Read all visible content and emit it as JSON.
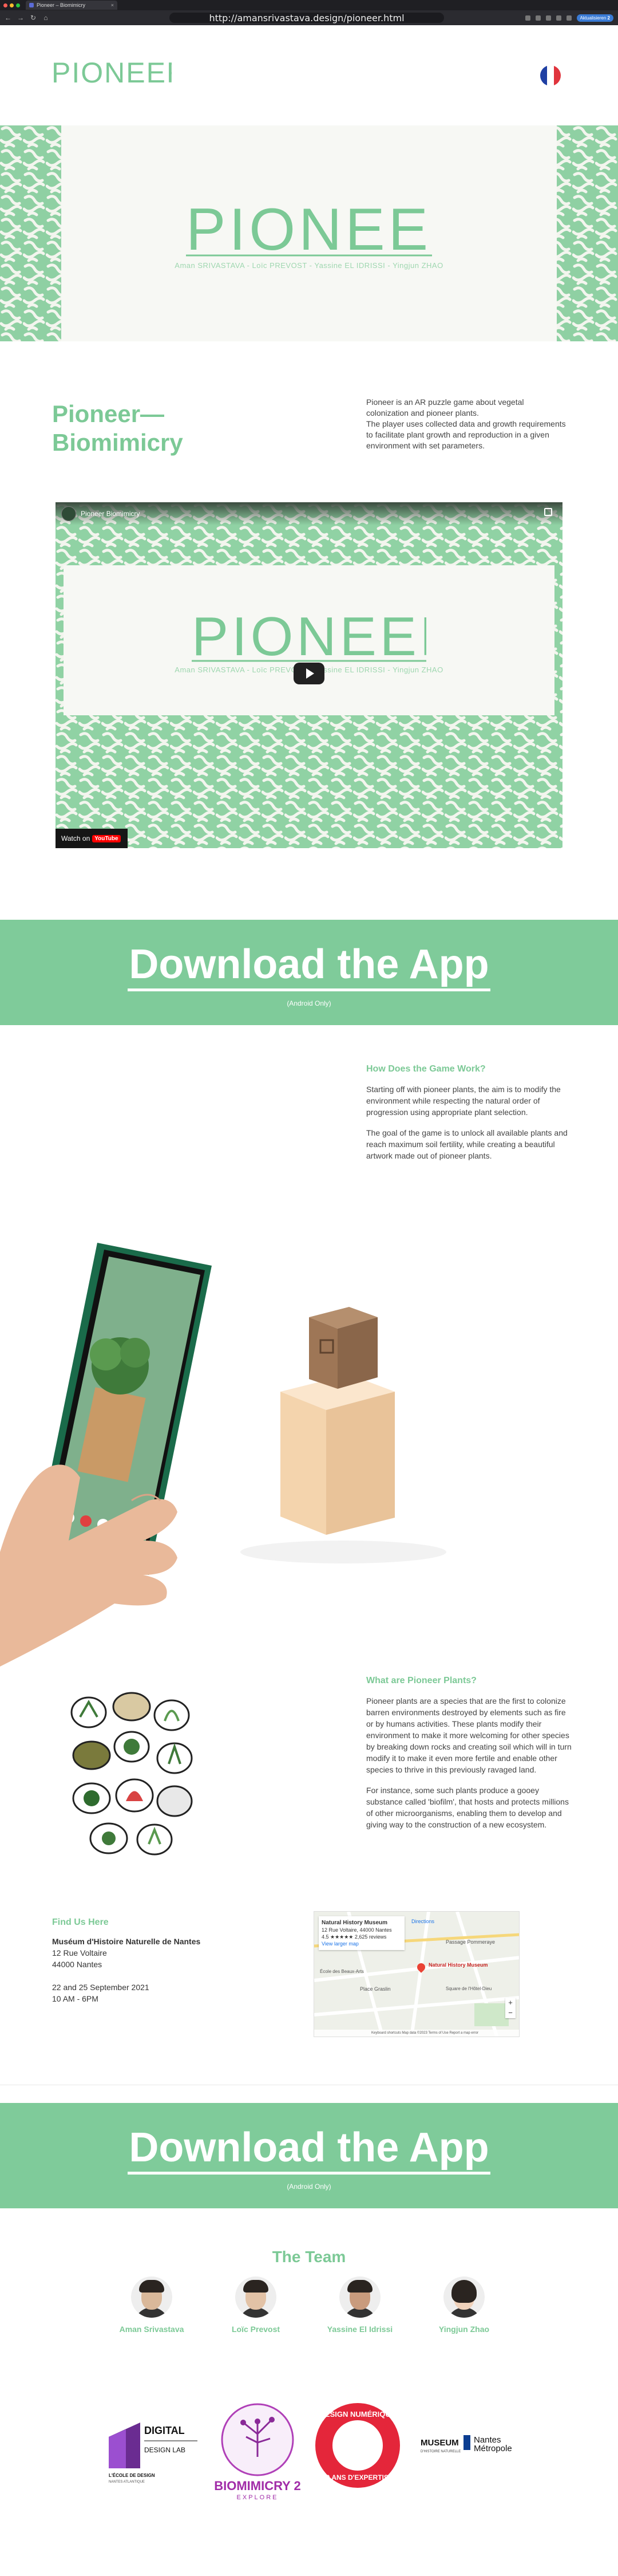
{
  "browser": {
    "tab_title": "Pioneer – Biomimicry",
    "url": "http://amansrivastava.design/pioneer.html",
    "update_label": "Aktualisieren",
    "update_count": "2"
  },
  "brand": {
    "logo_text": "PIONEER",
    "green": "#7cc996",
    "light_green": "#8fd0a3"
  },
  "hero": {
    "logo_text": "PIONEER",
    "team_line": "Aman SRIVASTAVA - Loïc PREVOST - Yassine EL IDRISSI - Yingjun ZHAO"
  },
  "intro": {
    "title": "Pioneer—\nBiomimicry",
    "text": "Pioneer is an AR puzzle game about vegetal colonization and pioneer plants.\nThe player uses collected data and growth requirements to facilitate plant growth and reproduction in a given environment with set parameters."
  },
  "video": {
    "channel_title": "Pioneer Biomimicry",
    "share_label": "Share",
    "logo_text": "PIONEER",
    "team_line": "Aman SRIVASTAVA - Loïc PREVOST - Yassine EL IDRISSI - Yingjun ZHAO",
    "watch_on": "Watch on",
    "youtube": "YouTube"
  },
  "download": {
    "label": "Download the App",
    "note": "(Android Only)"
  },
  "how": {
    "heading": "How Does the Game Work?",
    "p1": "Starting off with pioneer plants, the aim is to modify the environment while respecting the natural order of progression using appropriate plant selection.",
    "p2": "The goal of the game is to unlock all available plants and reach maximum soil fertility, while creating a beautiful artwork made out of pioneer plants."
  },
  "what": {
    "heading": "What are Pioneer Plants?",
    "p1": "Pioneer plants are a species that are the first to colonize barren environments destroyed by elements such as fire or by humans activities. These plants modify their environment to make it more welcoming for other species by breaking down rocks and creating soil which will in turn modify it to make it even more fertile and enable other species to thrive in this previously ravaged land.",
    "p2": "For instance, some such plants produce a gooey substance called 'biofilm', that hosts and protects millions of other microorganisms, enabling them to develop and giving way to the construction of a new ecosystem."
  },
  "find_us": {
    "heading": "Find Us Here",
    "venue": "Muséum d'Histoire Naturelle de Nantes",
    "street": "12 Rue Voltaire",
    "city": "44000 Nantes",
    "dates": "22 and 25 September 2021",
    "hours": "10 AM - 6PM"
  },
  "map": {
    "place": "Natural History Museum",
    "address": "12 Rue Voltaire, 44000 Nantes",
    "rating": "4.5 ★★★★★ 2,625 reviews",
    "larger_map": "View larger map",
    "directions": "Directions",
    "label_museum": "Natural History Museum",
    "label_passage": "Passage Pommeraye",
    "label_graslin": "Place Graslin",
    "label_ecole": "École des Beaux-Arts",
    "label_square": "Square de l'Hôtel-Dieu",
    "footer": "Keyboard shortcuts  Map data ©2023  Terms of Use  Report a map error"
  },
  "team": {
    "heading": "The Team",
    "members": [
      {
        "name": "Aman Srivastava"
      },
      {
        "name": "Loïc Prevost"
      },
      {
        "name": "Yassine El Idrissi"
      },
      {
        "name": "Yingjun Zhao"
      }
    ]
  },
  "partners": {
    "digital": "DIGITAL",
    "design_lab": "DESIGN LAB",
    "ecole": "L'ÉCOLE DE DESIGN",
    "ecole_sub": "NANTES ATLANTIQUE",
    "biomimicry": "BIOMIMICRY 2",
    "explore": "EXPLORE",
    "design_num": "DESIGN NUMÉRIQUE",
    "ans": "20 ANS D'EXPERTISE",
    "museum": "MUSEUM",
    "museum_sub": "D'HISTOIRE NATURELLE",
    "nantes": "Nantes",
    "metropole": "Métropole"
  }
}
